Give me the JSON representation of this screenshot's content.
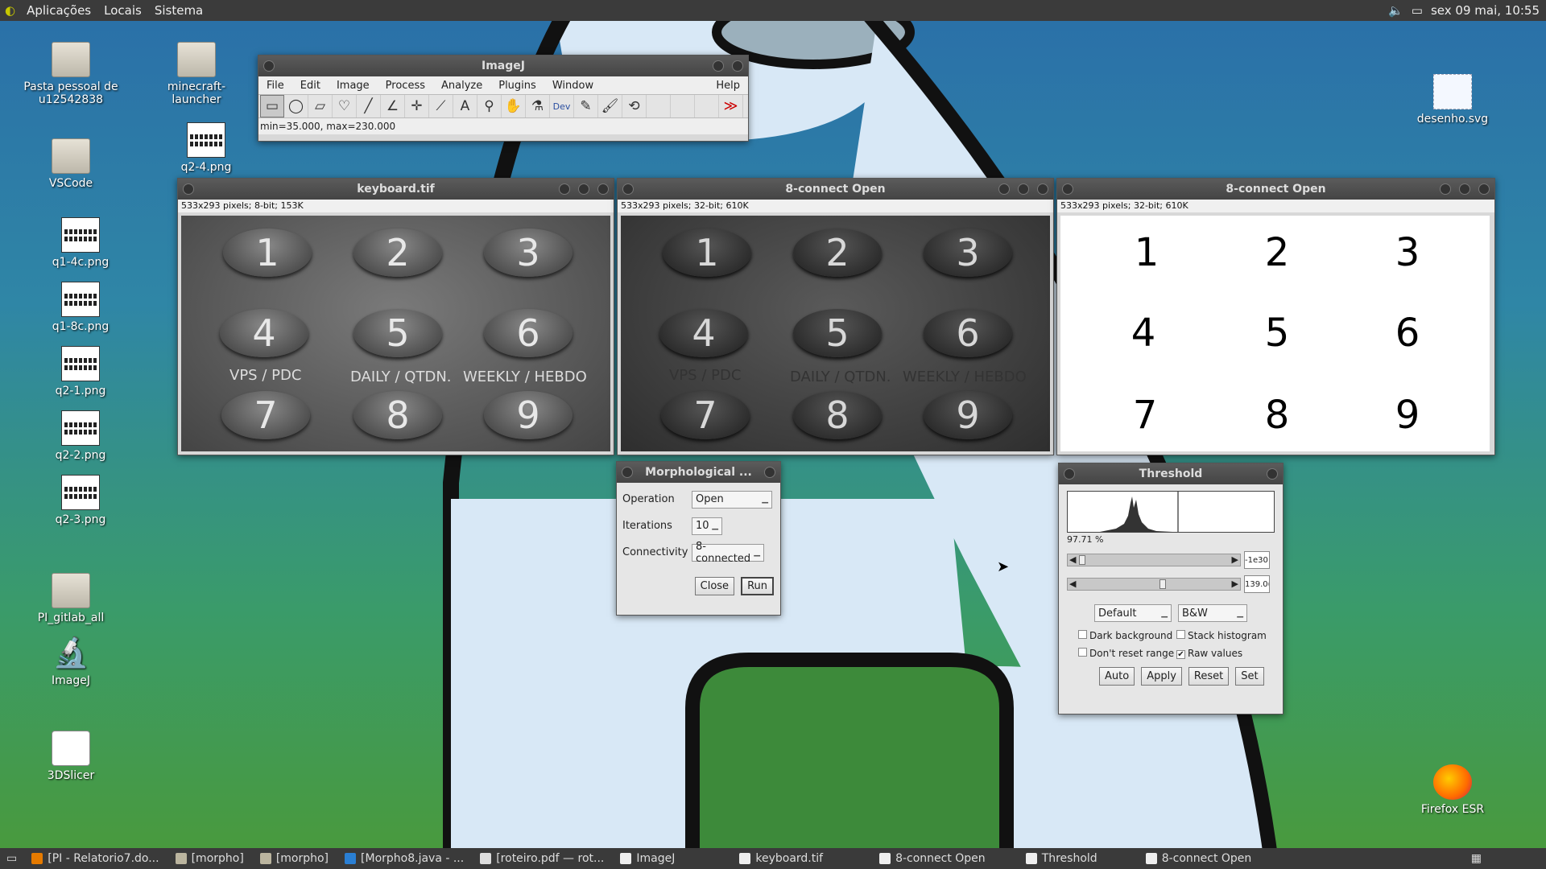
{
  "topbar": {
    "menus": [
      "Aplicações",
      "Locais",
      "Sistema"
    ],
    "clock": "sex 09 mai, 10:55"
  },
  "desktop": {
    "icons_left": [
      {
        "label": "Pasta pessoal de u12542838",
        "icon": "home-folder-icon"
      },
      {
        "label": "minecraft-launcher",
        "icon": "folder-icon"
      },
      {
        "label": "q2-4.png",
        "icon": "image-file-icon"
      },
      {
        "label": "VSCode",
        "icon": "folder-icon"
      },
      {
        "label": "q1-4c.png",
        "icon": "image-file-icon"
      },
      {
        "label": "q1-8c.png",
        "icon": "image-file-icon"
      },
      {
        "label": "q2-1.png",
        "icon": "image-file-icon"
      },
      {
        "label": "q2-2.png",
        "icon": "image-file-icon"
      },
      {
        "label": "q2-3.png",
        "icon": "image-file-icon"
      },
      {
        "label": "PI_gitlab_all",
        "icon": "folder-icon"
      },
      {
        "label": "ImageJ",
        "icon": "microscope-icon"
      },
      {
        "label": "3DSlicer",
        "icon": "slicer-icon"
      }
    ],
    "icons_right": [
      {
        "label": "desenho.svg",
        "icon": "svg-file-icon"
      },
      {
        "label": "Firefox ESR",
        "icon": "firefox-icon"
      }
    ]
  },
  "imagej": {
    "title": "ImageJ",
    "menu": [
      "File",
      "Edit",
      "Image",
      "Process",
      "Analyze",
      "Plugins",
      "Window",
      "Help"
    ],
    "tools": [
      "rectangle-tool-icon",
      "oval-tool-icon",
      "polygon-tool-icon",
      "freehand-tool-icon",
      "line-tool-icon",
      "angle-tool-icon",
      "point-tool-icon",
      "wand-tool-icon",
      "text-tool-icon",
      "magnifier-icon",
      "hand-icon",
      "dropper-icon",
      "dev-icon",
      "pencil-icon",
      "brush-icon",
      "flood-fill-icon",
      "more-tools-icon"
    ],
    "dev_label": "Dev",
    "more_label": "≫",
    "status": "min=35.000, max=230.000"
  },
  "windows": [
    {
      "title": "keyboard.tif",
      "info": "533x293 pixels; 8-bit; 153K",
      "labels": [
        "VPS / PDC",
        "DAILY / QTDN.",
        "WEEKLY / HEBDO"
      ]
    },
    {
      "title": "8-connect Open",
      "info": "533x293 pixels; 32-bit; 610K",
      "labels": [
        "VPS / PDC",
        "DAILY / QTDN.",
        "WEEKLY / HEBDO"
      ]
    },
    {
      "title": "8-connect Open",
      "info": "533x293 pixels; 32-bit; 610K"
    }
  ],
  "keys": [
    "1",
    "2",
    "3",
    "4",
    "5",
    "6",
    "7",
    "8",
    "9"
  ],
  "morph": {
    "title": "Morphological ...",
    "operation_label": "Operation",
    "operation_value": "Open",
    "iterations_label": "Iterations",
    "iterations_value": "10",
    "connectivity_label": "Connectivity",
    "connectivity_value": "8-connected",
    "close": "Close",
    "run": "Run"
  },
  "threshold": {
    "title": "Threshold",
    "percent": "97.71 %",
    "low_value": "-1e30",
    "high_value": "139.0(",
    "method": "Default",
    "mode": "B&W",
    "dark_background": "Dark background",
    "stack_histogram": "Stack histogram",
    "dont_reset": "Don't reset range",
    "raw_values": "Raw values",
    "raw_checked": true,
    "auto": "Auto",
    "apply": "Apply",
    "reset": "Reset",
    "set": "Set"
  },
  "taskbar": [
    "[PI - Relatorio7.do...",
    "[morpho]",
    "[morpho]",
    "[Morpho8.java - ...",
    "[roteiro.pdf — rot...",
    "ImageJ",
    "keyboard.tif",
    "8-connect Open",
    "Threshold",
    "8-connect Open"
  ]
}
